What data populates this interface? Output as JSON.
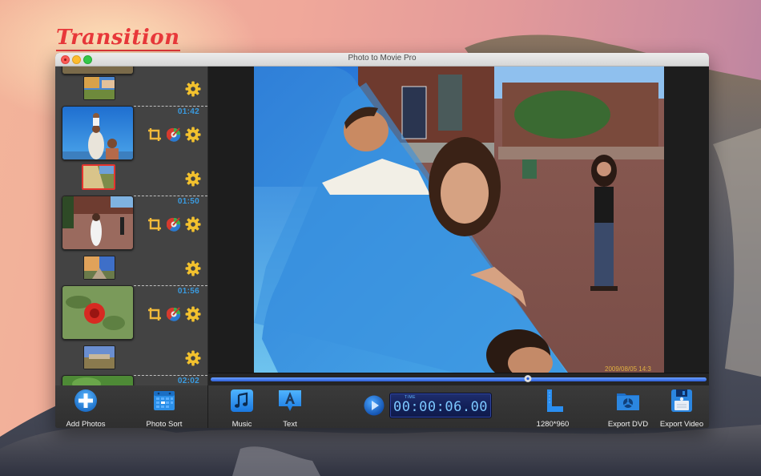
{
  "caption": "Transition",
  "window": {
    "title": "Photo to Movie Pro"
  },
  "colors": {
    "accent_blue": "#3a9be0",
    "caption_red": "#e8383a",
    "gear_yellow": "#f2c12e",
    "selection_red": "#e5342e",
    "timecode_blue": "#7cc8ff"
  },
  "sidebar": {
    "clips": [
      {
        "name": "family-beach",
        "duration": "01:42"
      },
      {
        "name": "woman-brick-plaza",
        "duration": "01:50"
      },
      {
        "name": "red-rose",
        "duration": "01:56"
      },
      {
        "name": "green-leaves",
        "duration": "02:02"
      }
    ],
    "transitions": [
      {
        "selected": false
      },
      {
        "selected": true
      },
      {
        "selected": false
      },
      {
        "selected": false
      }
    ]
  },
  "left_toolbar": {
    "add_photos": "Add Photos",
    "photo_sort": "Photo Sort"
  },
  "main_toolbar": {
    "music": "Music",
    "text": "Text",
    "time_label": "TIME",
    "timecode": "00:00:06.00",
    "resolution": "1280*960",
    "export_dvd": "Export DVD",
    "export_video": "Export Video"
  },
  "timeline": {
    "position_fraction": 0.64
  },
  "preview": {
    "date_stamp": "2009/08/05 14:3"
  }
}
